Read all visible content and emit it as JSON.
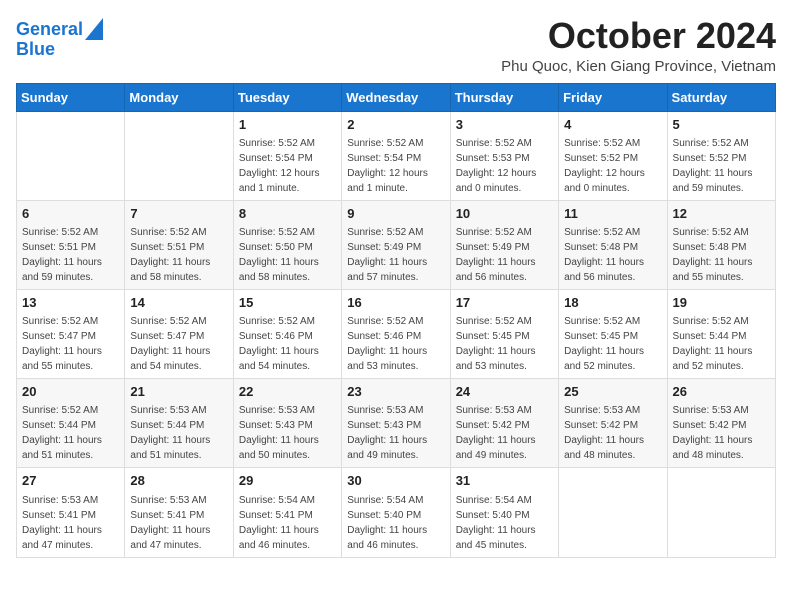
{
  "header": {
    "logo_line1": "General",
    "logo_line2": "Blue",
    "month_title": "October 2024",
    "subtitle": "Phu Quoc, Kien Giang Province, Vietnam"
  },
  "days_of_week": [
    "Sunday",
    "Monday",
    "Tuesday",
    "Wednesday",
    "Thursday",
    "Friday",
    "Saturday"
  ],
  "weeks": [
    [
      {
        "day": "",
        "info": ""
      },
      {
        "day": "",
        "info": ""
      },
      {
        "day": "1",
        "info": "Sunrise: 5:52 AM\nSunset: 5:54 PM\nDaylight: 12 hours\nand 1 minute."
      },
      {
        "day": "2",
        "info": "Sunrise: 5:52 AM\nSunset: 5:54 PM\nDaylight: 12 hours\nand 1 minute."
      },
      {
        "day": "3",
        "info": "Sunrise: 5:52 AM\nSunset: 5:53 PM\nDaylight: 12 hours\nand 0 minutes."
      },
      {
        "day": "4",
        "info": "Sunrise: 5:52 AM\nSunset: 5:52 PM\nDaylight: 12 hours\nand 0 minutes."
      },
      {
        "day": "5",
        "info": "Sunrise: 5:52 AM\nSunset: 5:52 PM\nDaylight: 11 hours\nand 59 minutes."
      }
    ],
    [
      {
        "day": "6",
        "info": "Sunrise: 5:52 AM\nSunset: 5:51 PM\nDaylight: 11 hours\nand 59 minutes."
      },
      {
        "day": "7",
        "info": "Sunrise: 5:52 AM\nSunset: 5:51 PM\nDaylight: 11 hours\nand 58 minutes."
      },
      {
        "day": "8",
        "info": "Sunrise: 5:52 AM\nSunset: 5:50 PM\nDaylight: 11 hours\nand 58 minutes."
      },
      {
        "day": "9",
        "info": "Sunrise: 5:52 AM\nSunset: 5:49 PM\nDaylight: 11 hours\nand 57 minutes."
      },
      {
        "day": "10",
        "info": "Sunrise: 5:52 AM\nSunset: 5:49 PM\nDaylight: 11 hours\nand 56 minutes."
      },
      {
        "day": "11",
        "info": "Sunrise: 5:52 AM\nSunset: 5:48 PM\nDaylight: 11 hours\nand 56 minutes."
      },
      {
        "day": "12",
        "info": "Sunrise: 5:52 AM\nSunset: 5:48 PM\nDaylight: 11 hours\nand 55 minutes."
      }
    ],
    [
      {
        "day": "13",
        "info": "Sunrise: 5:52 AM\nSunset: 5:47 PM\nDaylight: 11 hours\nand 55 minutes."
      },
      {
        "day": "14",
        "info": "Sunrise: 5:52 AM\nSunset: 5:47 PM\nDaylight: 11 hours\nand 54 minutes."
      },
      {
        "day": "15",
        "info": "Sunrise: 5:52 AM\nSunset: 5:46 PM\nDaylight: 11 hours\nand 54 minutes."
      },
      {
        "day": "16",
        "info": "Sunrise: 5:52 AM\nSunset: 5:46 PM\nDaylight: 11 hours\nand 53 minutes."
      },
      {
        "day": "17",
        "info": "Sunrise: 5:52 AM\nSunset: 5:45 PM\nDaylight: 11 hours\nand 53 minutes."
      },
      {
        "day": "18",
        "info": "Sunrise: 5:52 AM\nSunset: 5:45 PM\nDaylight: 11 hours\nand 52 minutes."
      },
      {
        "day": "19",
        "info": "Sunrise: 5:52 AM\nSunset: 5:44 PM\nDaylight: 11 hours\nand 52 minutes."
      }
    ],
    [
      {
        "day": "20",
        "info": "Sunrise: 5:52 AM\nSunset: 5:44 PM\nDaylight: 11 hours\nand 51 minutes."
      },
      {
        "day": "21",
        "info": "Sunrise: 5:53 AM\nSunset: 5:44 PM\nDaylight: 11 hours\nand 51 minutes."
      },
      {
        "day": "22",
        "info": "Sunrise: 5:53 AM\nSunset: 5:43 PM\nDaylight: 11 hours\nand 50 minutes."
      },
      {
        "day": "23",
        "info": "Sunrise: 5:53 AM\nSunset: 5:43 PM\nDaylight: 11 hours\nand 49 minutes."
      },
      {
        "day": "24",
        "info": "Sunrise: 5:53 AM\nSunset: 5:42 PM\nDaylight: 11 hours\nand 49 minutes."
      },
      {
        "day": "25",
        "info": "Sunrise: 5:53 AM\nSunset: 5:42 PM\nDaylight: 11 hours\nand 48 minutes."
      },
      {
        "day": "26",
        "info": "Sunrise: 5:53 AM\nSunset: 5:42 PM\nDaylight: 11 hours\nand 48 minutes."
      }
    ],
    [
      {
        "day": "27",
        "info": "Sunrise: 5:53 AM\nSunset: 5:41 PM\nDaylight: 11 hours\nand 47 minutes."
      },
      {
        "day": "28",
        "info": "Sunrise: 5:53 AM\nSunset: 5:41 PM\nDaylight: 11 hours\nand 47 minutes."
      },
      {
        "day": "29",
        "info": "Sunrise: 5:54 AM\nSunset: 5:41 PM\nDaylight: 11 hours\nand 46 minutes."
      },
      {
        "day": "30",
        "info": "Sunrise: 5:54 AM\nSunset: 5:40 PM\nDaylight: 11 hours\nand 46 minutes."
      },
      {
        "day": "31",
        "info": "Sunrise: 5:54 AM\nSunset: 5:40 PM\nDaylight: 11 hours\nand 45 minutes."
      },
      {
        "day": "",
        "info": ""
      },
      {
        "day": "",
        "info": ""
      }
    ]
  ]
}
